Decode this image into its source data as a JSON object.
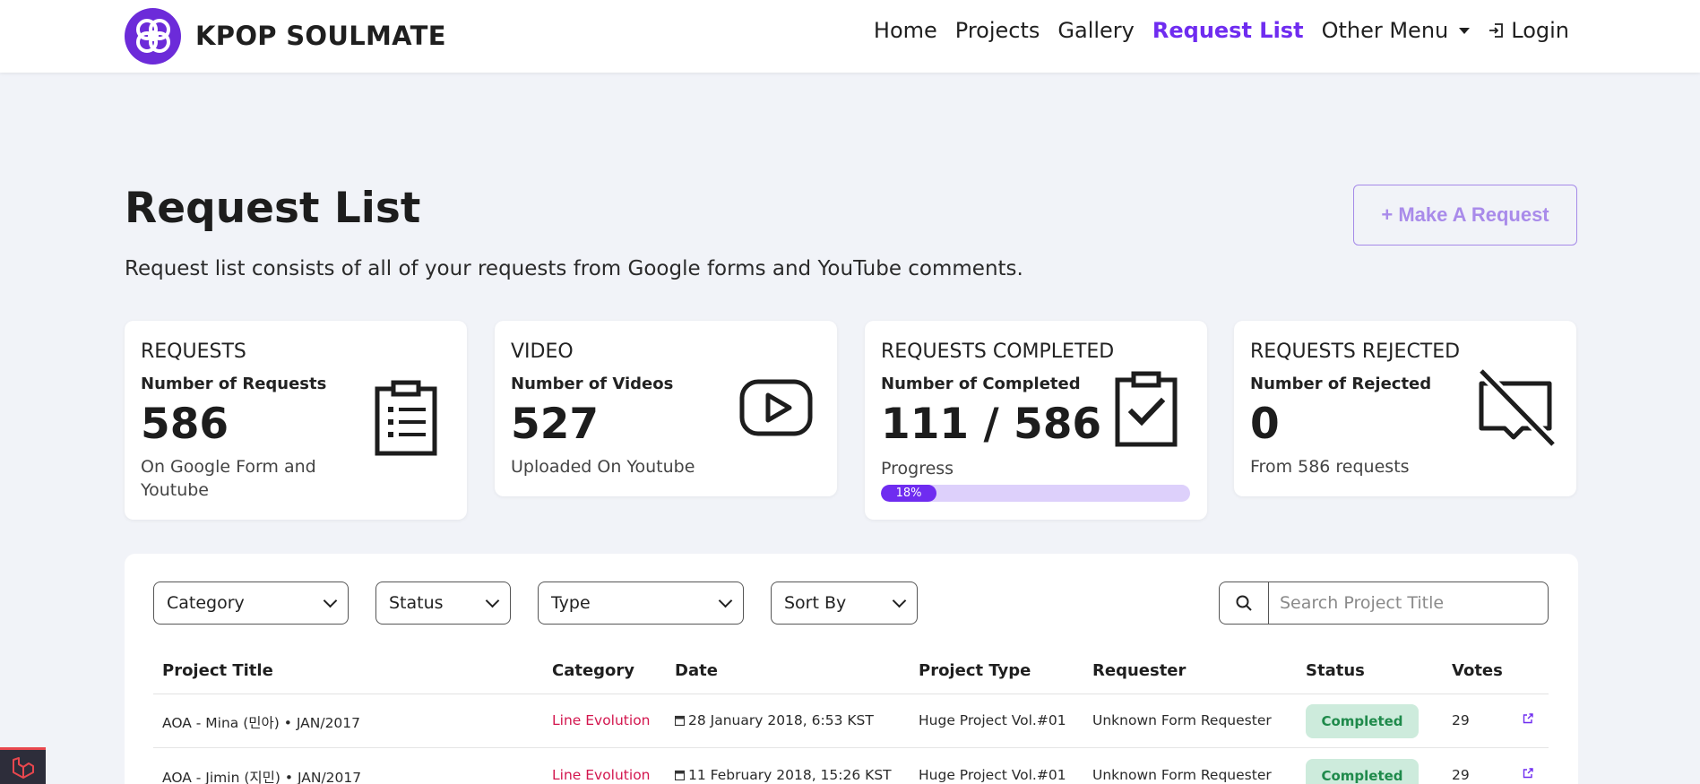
{
  "brand": {
    "name": "KPOP SOULMATE"
  },
  "nav": {
    "items": [
      {
        "label": "Home"
      },
      {
        "label": "Projects"
      },
      {
        "label": "Gallery"
      },
      {
        "label": "Request List"
      },
      {
        "label": "Other Menu"
      },
      {
        "label": "Login"
      }
    ],
    "active": "Request List"
  },
  "header": {
    "title": "Request List",
    "description": "Request list consists of all of your requests from Google forms and YouTube comments.",
    "make_request_label": "+ Make A Request"
  },
  "stats": [
    {
      "heading": "REQUESTS",
      "sub": "Number of Requests",
      "value": "586",
      "note": "On Google Form and Youtube",
      "icon": "clipboard-list-icon"
    },
    {
      "heading": "VIDEO",
      "sub": "Number of Videos",
      "value": "527",
      "note": "Uploaded On Youtube",
      "icon": "youtube-play-icon"
    },
    {
      "heading": "REQUESTS COMPLETED",
      "sub": "Number of Completed",
      "value": "111 / 586",
      "note": "Progress",
      "progress_label": "18%",
      "progress_percent": 18,
      "icon": "clipboard-check-icon"
    },
    {
      "heading": "REQUESTS REJECTED",
      "sub": "Number of Rejected",
      "value": "0",
      "note": "From 586 requests",
      "icon": "comment-slash-icon"
    }
  ],
  "filters": {
    "category": "Category",
    "status": "Status",
    "type": "Type",
    "sort": "Sort By",
    "search_placeholder": "Search Project Title"
  },
  "table": {
    "headers": {
      "title": "Project Title",
      "category": "Category",
      "date": "Date",
      "type": "Project Type",
      "requester": "Requester",
      "status": "Status",
      "votes": "Votes"
    },
    "rows": [
      {
        "title": "AOA - Mina (민아) • JAN/2017",
        "category": "Line Evolution",
        "date": "28 January 2018, 6:53 KST",
        "type": "Huge Project Vol.#01",
        "requester": "Unknown Form Requester",
        "status": "Completed",
        "votes": "29"
      },
      {
        "title": "AOA - Jimin (지민) • JAN/2017",
        "category": "Line Evolution",
        "date": "11 February 2018, 15:26 KST",
        "type": "Huge Project Vol.#01",
        "requester": "Unknown Form Requester",
        "status": "Completed",
        "votes": "29"
      }
    ]
  },
  "colors": {
    "accent": "#6f2cf0",
    "background": "#f1f3f8",
    "category_text": "#d3164e",
    "badge_bg": "#cdebdc",
    "badge_text": "#1f8a4b"
  }
}
